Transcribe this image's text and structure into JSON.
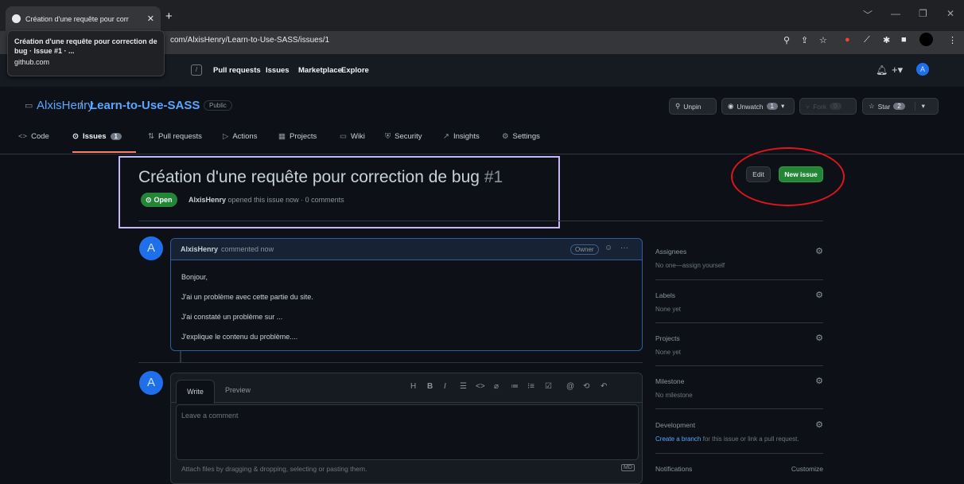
{
  "browser": {
    "tab_title": "Création d'une requête pour corr",
    "tab_close": "✕",
    "new_tab": "+",
    "url": "com/AlxisHenry/Learn-to-Use-SASS/issues/1",
    "tooltip_title": "Création d'une requête pour correction de bug · Issue #1 · ...",
    "tooltip_url": "github.com",
    "window_controls": [
      "﹀",
      "—",
      "❐",
      "✕"
    ],
    "toolbar_icons": [
      "zoom-icon",
      "share-icon",
      "star-icon",
      "extension-icons",
      "profile-icon",
      "menu-icon"
    ]
  },
  "gh_header": {
    "slash_key": "/",
    "nav": [
      "Pull requests",
      "Issues",
      "Marketplace",
      "Explore"
    ]
  },
  "repo": {
    "owner": "AlxisHenry",
    "separator": "/",
    "name": "Learn-to-Use-SASS",
    "visibility": "Public",
    "unpin": "Unpin",
    "unwatch": "Unwatch",
    "watch_count": "1",
    "fork": "Fork",
    "fork_count": "0",
    "star": "Star",
    "star_count": "2"
  },
  "tabs": [
    {
      "icon": "<>",
      "label": "Code"
    },
    {
      "icon": "⊙",
      "label": "Issues",
      "count": "1"
    },
    {
      "icon": "⇅",
      "label": "Pull requests"
    },
    {
      "icon": "▷",
      "label": "Actions"
    },
    {
      "icon": "▦",
      "label": "Projects"
    },
    {
      "icon": "▭",
      "label": "Wiki"
    },
    {
      "icon": "⛨",
      "label": "Security"
    },
    {
      "icon": "↗",
      "label": "Insights"
    },
    {
      "icon": "⚙",
      "label": "Settings"
    }
  ],
  "issue": {
    "title": "Création d'une requête pour correction de bug",
    "number": "#1",
    "state": "Open",
    "author": "AlxisHenry",
    "meta": "opened this issue now · 0 comments",
    "edit": "Edit",
    "new_issue": "New issue"
  },
  "comment": {
    "author": "AlxisHenry",
    "time": "commented now",
    "badge": "Owner",
    "lines": [
      "Bonjour,",
      "J'ai un problème avec cette partie du site.",
      "J'ai constaté un problème sur ...",
      "J'explique le contenu du problème...."
    ]
  },
  "editor": {
    "write": "Write",
    "preview": "Preview",
    "tools": [
      "H",
      "B",
      "I",
      "☰",
      "<>",
      "⌀",
      "≔",
      "⁝≡",
      "☑",
      "@",
      "⟲",
      "↶"
    ],
    "placeholder": "Leave a comment",
    "attach": "Attach files by dragging & dropping, selecting or pasting them.",
    "md": "MD"
  },
  "sidebar": {
    "assignees": "Assignees",
    "assignees_value": "No one—assign yourself",
    "labels": "Labels",
    "labels_value": "None yet",
    "projects": "Projects",
    "projects_value": "None yet",
    "milestone": "Milestone",
    "milestone_value": "No milestone",
    "development": "Development",
    "dev_link": "Create a branch",
    "dev_rest": "for this issue or link a pull request.",
    "notifications": "Notifications",
    "customize": "Customize"
  },
  "avatar_glyph": "A"
}
